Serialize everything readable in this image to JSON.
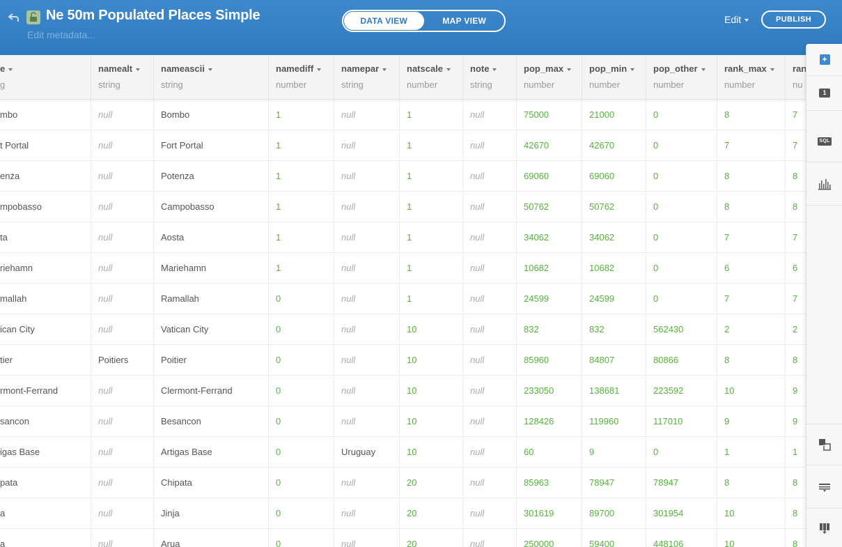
{
  "header": {
    "title": "Ne 50m Populated Places Simple",
    "edit_metadata": "Edit metadata...",
    "data_view": "DATA VIEW",
    "map_view": "MAP VIEW",
    "edit": "Edit",
    "publish": "PUBLISH"
  },
  "columns": [
    {
      "name": "name",
      "type": "string",
      "shown_name": "e",
      "shown_type": "g"
    },
    {
      "name": "namealt",
      "type": "string"
    },
    {
      "name": "nameascii",
      "type": "string"
    },
    {
      "name": "namediff",
      "type": "number"
    },
    {
      "name": "namepar",
      "type": "string"
    },
    {
      "name": "natscale",
      "type": "number"
    },
    {
      "name": "note",
      "type": "string"
    },
    {
      "name": "pop_max",
      "type": "number"
    },
    {
      "name": "pop_min",
      "type": "number"
    },
    {
      "name": "pop_other",
      "type": "number"
    },
    {
      "name": "rank_max",
      "type": "number"
    },
    {
      "name": "rank_min",
      "type": "number",
      "shown_name": "ran",
      "shown_type": "nu"
    }
  ],
  "rows": [
    [
      "mbo",
      "null",
      "Bombo",
      "1",
      "null",
      "1",
      "null",
      "75000",
      "21000",
      "0",
      "8",
      "7"
    ],
    [
      "t Portal",
      "null",
      "Fort Portal",
      "1",
      "null",
      "1",
      "null",
      "42670",
      "42670",
      "0",
      "7",
      "7"
    ],
    [
      "enza",
      "null",
      "Potenza",
      "1",
      "null",
      "1",
      "null",
      "69060",
      "69060",
      "0",
      "8",
      "8"
    ],
    [
      "mpobasso",
      "null",
      "Campobasso",
      "1",
      "null",
      "1",
      "null",
      "50762",
      "50762",
      "0",
      "8",
      "8"
    ],
    [
      "ta",
      "null",
      "Aosta",
      "1",
      "null",
      "1",
      "null",
      "34062",
      "34062",
      "0",
      "7",
      "7"
    ],
    [
      "riehamn",
      "null",
      "Mariehamn",
      "1",
      "null",
      "1",
      "null",
      "10682",
      "10682",
      "0",
      "6",
      "6"
    ],
    [
      "mallah",
      "null",
      "Ramallah",
      "0",
      "null",
      "1",
      "null",
      "24599",
      "24599",
      "0",
      "7",
      "7"
    ],
    [
      "ican City",
      "null",
      "Vatican City",
      "0",
      "null",
      "10",
      "null",
      "832",
      "832",
      "562430",
      "2",
      "2"
    ],
    [
      "tier",
      "Poitiers",
      "Poitier",
      "0",
      "null",
      "10",
      "null",
      "85960",
      "84807",
      "80866",
      "8",
      "8"
    ],
    [
      "rmont-Ferrand",
      "null",
      "Clermont-Ferrand",
      "0",
      "null",
      "10",
      "null",
      "233050",
      "138681",
      "223592",
      "10",
      "9"
    ],
    [
      "sancon",
      "null",
      "Besancon",
      "0",
      "null",
      "10",
      "null",
      "128426",
      "119960",
      "117010",
      "9",
      "9"
    ],
    [
      "igas Base",
      "null",
      "Artigas Base",
      "0",
      "Uruguay",
      "10",
      "null",
      "60",
      "9",
      "0",
      "1",
      "1"
    ],
    [
      "pata",
      "null",
      "Chipata",
      "0",
      "null",
      "20",
      "null",
      "85963",
      "78947",
      "78947",
      "8",
      "8"
    ],
    [
      "a",
      "null",
      "Jinja",
      "0",
      "null",
      "20",
      "null",
      "301619",
      "89700",
      "301954",
      "10",
      "8"
    ],
    [
      "a",
      "null",
      "Arua",
      "0",
      "null",
      "20",
      "null",
      "250000",
      "59400",
      "448106",
      "10",
      "8"
    ]
  ],
  "icons": {
    "back": "back-arrow-icon",
    "lock": "unlocked-padlock-icon",
    "sidebar": [
      "add-layer-icon",
      "layer-count-icon",
      "sql-icon",
      "chart-icon",
      "merge-tables-icon",
      "filter-rows-icon",
      "columns-icon"
    ]
  },
  "colors": {
    "header": "#3e88cc",
    "number_text": "#55b339",
    "null_text": "#aaaaaa",
    "string_text": "#555555"
  },
  "sidebar": {
    "layer_count": "1",
    "sql_label": "SQL"
  }
}
